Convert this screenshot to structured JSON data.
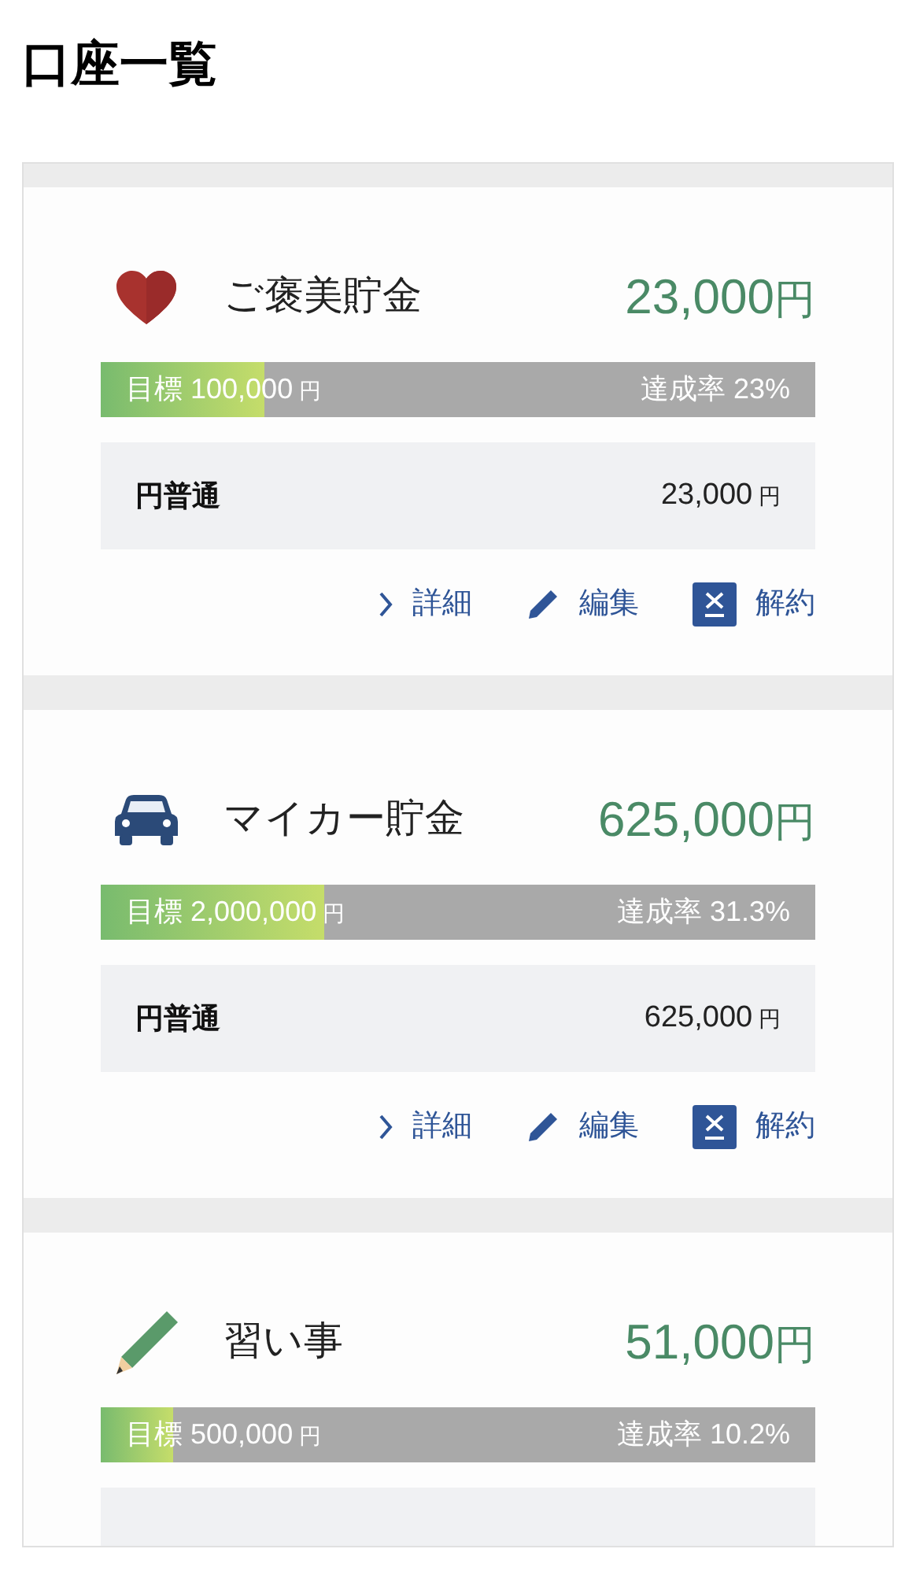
{
  "title": "口座一覧",
  "accounts": [
    {
      "kind": "heart",
      "name": "ご褒美貯金",
      "amount": "23,000",
      "currency": "円",
      "goal_label": "目標",
      "goal": "100,000",
      "goal_unit": "円",
      "rate_label": "達成率",
      "rate": "23%",
      "level": 0.23,
      "account": {
        "type": "円普通",
        "balance": "23,000",
        "unit": "円"
      },
      "actions": [
        {
          "kind": "detail",
          "label": "詳細"
        },
        {
          "kind": "edit",
          "label": "編集"
        },
        {
          "kind": "cancel",
          "label": "解約"
        }
      ]
    },
    {
      "kind": "car",
      "name": "マイカー貯金",
      "amount": "625,000",
      "currency": "円",
      "goal_label": "目標",
      "goal": "2,000,000",
      "goal_unit": "円",
      "rate_label": "達成率",
      "rate": "31.3%",
      "level": 0.313,
      "account": {
        "type": "円普通",
        "balance": "625,000",
        "unit": "円"
      },
      "actions": [
        {
          "kind": "detail",
          "label": "詳細"
        },
        {
          "kind": "edit",
          "label": "編集"
        },
        {
          "kind": "cancel",
          "label": "解約"
        }
      ]
    },
    {
      "kind": "pencil",
      "name": "習い事",
      "amount": "51,000",
      "currency": "円",
      "goal_label": "目標",
      "goal": "500,000",
      "goal_unit": "円",
      "rate_label": "達成率",
      "rate": "10.2%",
      "level": 0.102
    }
  ]
}
